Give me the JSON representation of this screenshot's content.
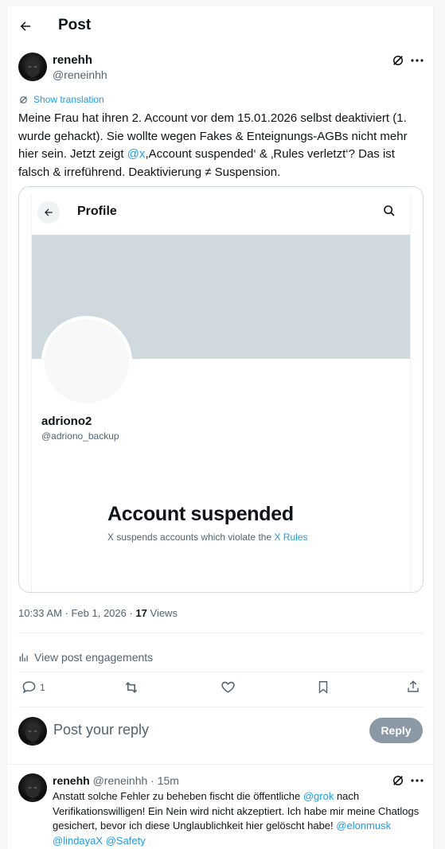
{
  "header": {
    "title": "Post"
  },
  "post": {
    "author_name": "renehh",
    "author_handle": "@reneinhh",
    "show_translation": "Show translation",
    "text_part1": "Meine Frau hat ihren 2. Account vor dem 15.01.2026 selbst deaktiviert (1. wurde gehackt). Sie wollte wegen Fakes & Enteignungs-AGBs nicht mehr hier sein. Jetzt zeigt ",
    "text_mention": "@x",
    "text_part2": ",Account suspended‘ & ‚Rules verletzt‘? Das ist falsch & irreführend. Deaktivierung ≠ Suspension.",
    "timestamp": "10:33 AM · Feb 1, 2026 · ",
    "views_count": "17",
    "views_label": " Views",
    "engagements_label": "View post engagements",
    "reply_count": "1"
  },
  "media": {
    "profile_title": "Profile",
    "name": "adriono2",
    "handle": "@adriono_backup",
    "suspended_title": "Account suspended",
    "suspended_sub": "X suspends accounts which violate the ",
    "suspended_link": "X Rules"
  },
  "composer": {
    "placeholder": "Post your reply",
    "button": "Reply"
  },
  "reply": {
    "author_name": "renehh",
    "author_handle": "@reneinhh",
    "time": " · 15m",
    "text_part1": "Anstatt solche Fehler zu beheben fischt die öffentliche ",
    "mention1": "@grok",
    "text_part2": " nach Verifikationswilligen! Ein Nein wird nicht akzeptiert. Ich habe mir meine Chatlogs gesichert, bevor ich diese Unglaublichkeit hier gelöscht habe! ",
    "mention2": "@elonmusk",
    "mention3": "@lindayaX",
    "mention4": "@Safety"
  },
  "colors": {
    "accent": "#1d9bf0",
    "text": "#0f1419",
    "secondary": "#536471",
    "banner": "#cfd9de",
    "reply_button": "#8b98a5"
  }
}
